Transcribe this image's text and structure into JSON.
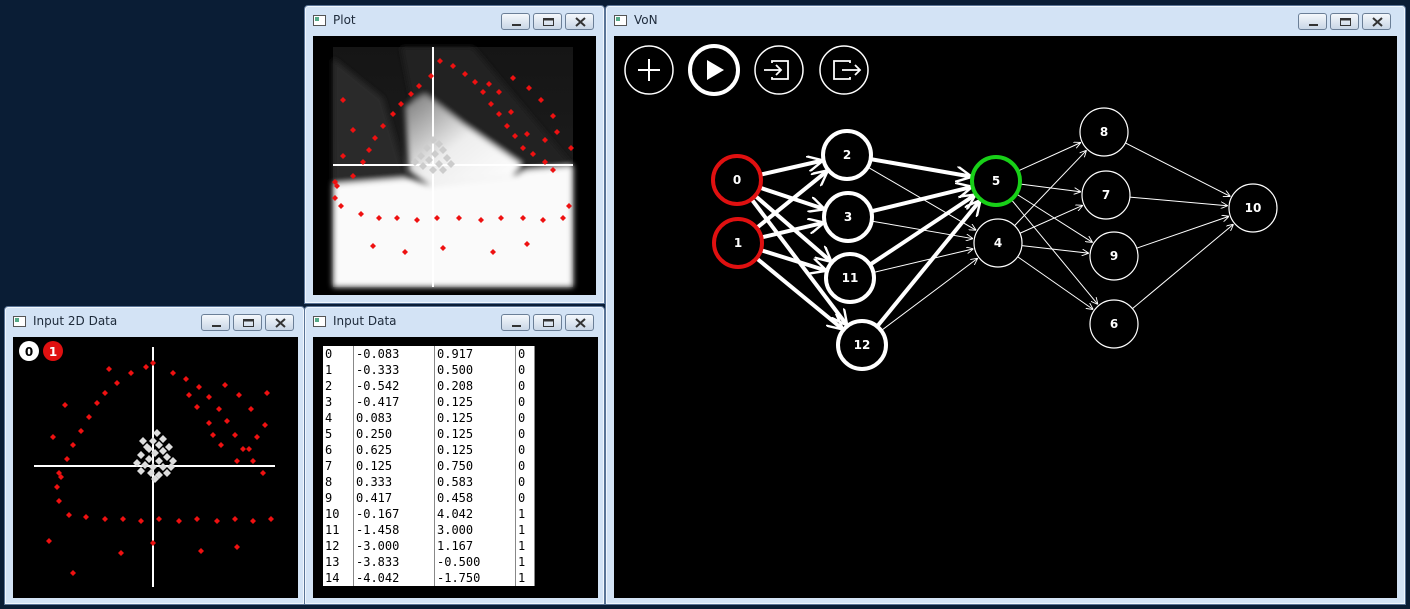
{
  "windows": {
    "plot": {
      "title": "Plot"
    },
    "input2d": {
      "title": "Input 2D Data",
      "legend": [
        "0",
        "1"
      ]
    },
    "inputdata": {
      "title": "Input Data"
    },
    "von": {
      "title": "VoN"
    }
  },
  "table": {
    "rows": [
      [
        "0",
        "-0.083",
        "0.917",
        "0"
      ],
      [
        "1",
        "-0.333",
        "0.500",
        "0"
      ],
      [
        "2",
        "-0.542",
        "0.208",
        "0"
      ],
      [
        "3",
        "-0.417",
        "0.125",
        "0"
      ],
      [
        "4",
        "0.083",
        "0.125",
        "0"
      ],
      [
        "5",
        "0.250",
        "0.125",
        "0"
      ],
      [
        "6",
        "0.625",
        "0.125",
        "0"
      ],
      [
        "7",
        "0.125",
        "0.750",
        "0"
      ],
      [
        "8",
        "0.333",
        "0.583",
        "0"
      ],
      [
        "9",
        "0.417",
        "0.458",
        "0"
      ],
      [
        "10",
        "-0.167",
        "4.042",
        "1"
      ],
      [
        "11",
        "-1.458",
        "3.000",
        "1"
      ],
      [
        "12",
        "-3.000",
        "1.167",
        "1"
      ],
      [
        "13",
        "-3.833",
        "-0.500",
        "1"
      ],
      [
        "14",
        "-4.042",
        "-1.750",
        "1"
      ]
    ]
  },
  "network": {
    "toolbar": [
      "add-icon",
      "play-icon",
      "import-icon",
      "export-icon"
    ],
    "nodes": [
      "0",
      "1",
      "2",
      "3",
      "11",
      "12",
      "5",
      "4",
      "8",
      "7",
      "9",
      "6",
      "10"
    ],
    "colors": {
      "input": "#e01010",
      "active": "#18d018",
      "node": "#ffffff"
    }
  },
  "colors": {
    "class0": "#dddddd",
    "class1": "#ee1111",
    "desktop": "#0a1d35",
    "chrome": "#d3e3f5"
  }
}
